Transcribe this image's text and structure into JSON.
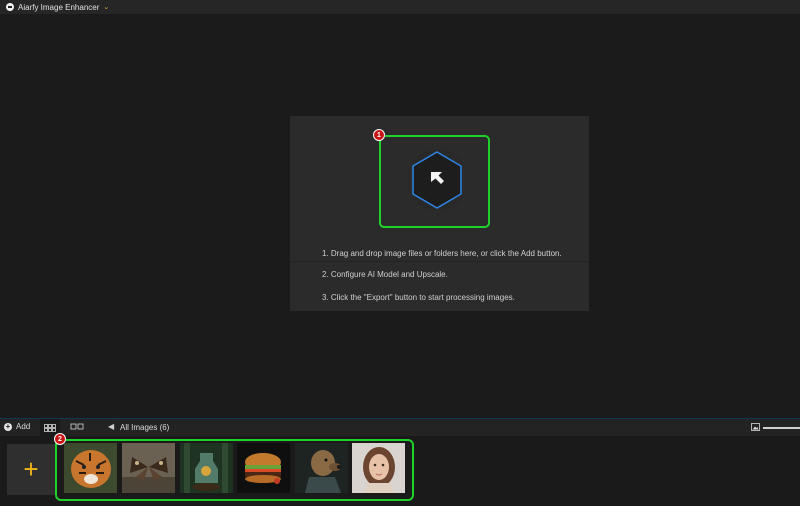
{
  "app": {
    "title": "Aiarfy Image Enhancer"
  },
  "drop_panel": {
    "badge": "1",
    "steps": [
      "1. Drag and drop image files or folders here, or click the Add button.",
      "2. Configure AI Model and Upscale.",
      "3. Click the \"Export\" button to start processing images."
    ]
  },
  "toolbar": {
    "add_label": "Add",
    "all_images_label": "All Images (6)"
  },
  "filmstrip": {
    "add_tile_label": "+",
    "badge": "2",
    "thumbnails": [
      "tiger",
      "butterfly",
      "forest-potion",
      "burger",
      "dog-portrait",
      "woman-portrait"
    ]
  },
  "colors": {
    "accent_green": "#1fd12a",
    "accent_yellow": "#f0b419",
    "badge_red": "#c81414",
    "hex_blue": "#2f86e8"
  }
}
